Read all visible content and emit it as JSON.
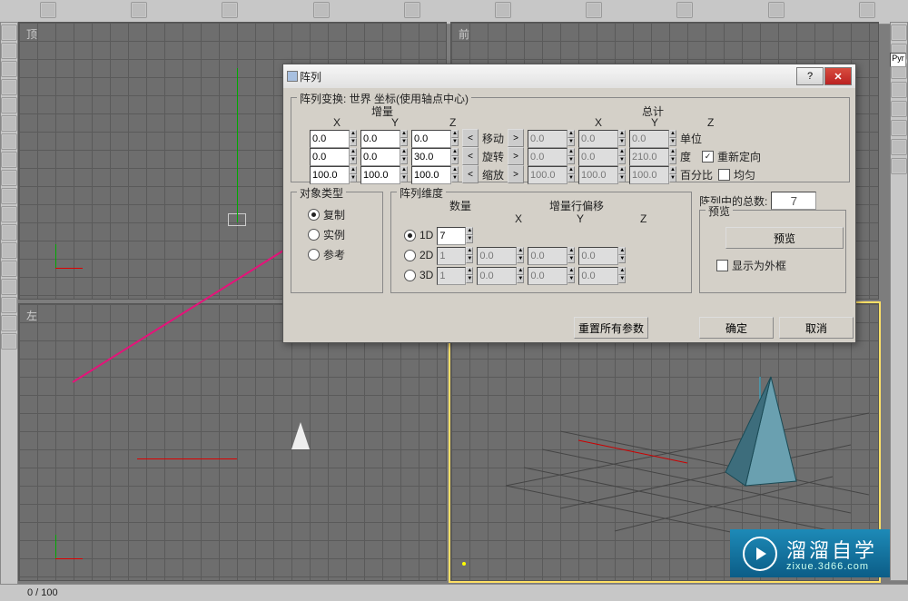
{
  "viewports": {
    "top": "顶",
    "front": "前",
    "left": "左"
  },
  "dialog": {
    "title": "阵列",
    "help": "?",
    "close": "✕",
    "transform_label": "阵列变换: 世界 坐标(使用轴点中心)",
    "increment_label": "增量",
    "total_label": "总计",
    "axes": {
      "x": "X",
      "y": "Y",
      "z": "Z"
    },
    "rows": {
      "move": {
        "label": "移动",
        "unit": "单位",
        "incX": "0.0",
        "incY": "0.0",
        "incZ": "0.0",
        "totX": "0.0",
        "totY": "0.0",
        "totZ": "0.0"
      },
      "rotate": {
        "label": "旋转",
        "unit": "度",
        "incX": "0.0",
        "incY": "0.0",
        "incZ": "30.0",
        "totX": "0.0",
        "totY": "0.0",
        "totZ": "210.0"
      },
      "scale": {
        "label": "缩放",
        "unit": "百分比",
        "incX": "100.0",
        "incY": "100.0",
        "incZ": "100.0",
        "totX": "100.0",
        "totY": "100.0",
        "totZ": "100.0"
      }
    },
    "reorient": {
      "label": "重新定向"
    },
    "uniform": {
      "label": "均匀"
    },
    "objtype": {
      "title": "对象类型",
      "copy": "复制",
      "instance": "实例",
      "reference": "参考"
    },
    "dim": {
      "title": "阵列维度",
      "count": "数量",
      "rowoffset": "增量行偏移",
      "d1": {
        "label": "1D",
        "count": "7"
      },
      "d2": {
        "label": "2D",
        "count": "1",
        "x": "0.0",
        "y": "0.0",
        "z": "0.0"
      },
      "d3": {
        "label": "3D",
        "count": "1",
        "x": "0.0",
        "y": "0.0",
        "z": "0.0"
      }
    },
    "total": {
      "label": "阵列中的总数:",
      "val": "7"
    },
    "preview": {
      "title": "预览",
      "btn": "预览",
      "wire": "显示为外框"
    },
    "reset": "重置所有参数",
    "ok": "确定",
    "cancel": "取消"
  },
  "status": "0  /  100",
  "sidebar": {
    "pyr": "Pyr"
  },
  "watermark": {
    "main": "溜溜自学",
    "sub": "zixue.3d66.com"
  }
}
